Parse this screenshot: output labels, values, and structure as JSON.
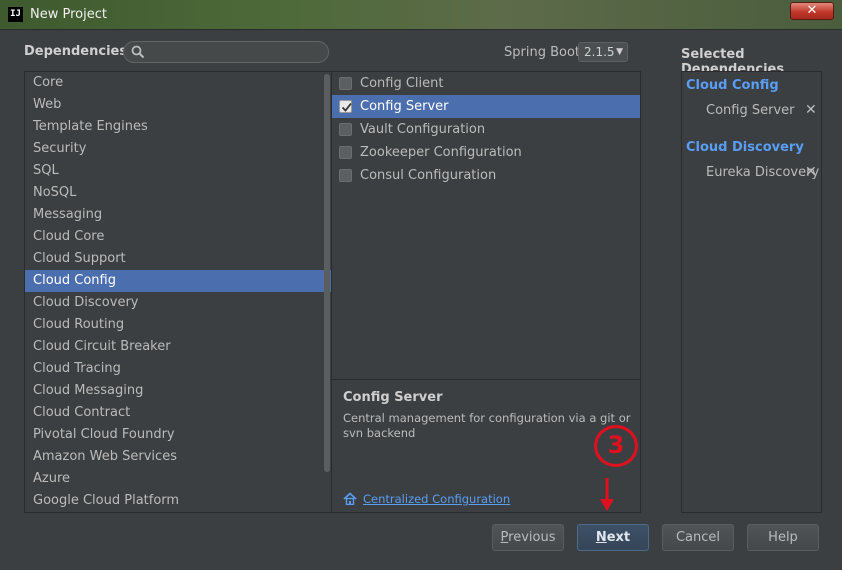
{
  "window": {
    "title": "New Project",
    "icon_text": "IJ",
    "close_label": "✕"
  },
  "header": {
    "dependencies_label": "Dependencies",
    "search_placeholder": "",
    "spring_boot_label": "Spring Boot",
    "spring_boot_version": "2.1.5",
    "selected_label": "Selected Dependencies"
  },
  "categories": [
    "Core",
    "Web",
    "Template Engines",
    "Security",
    "SQL",
    "NoSQL",
    "Messaging",
    "Cloud Core",
    "Cloud Support",
    "Cloud Config",
    "Cloud Discovery",
    "Cloud Routing",
    "Cloud Circuit Breaker",
    "Cloud Tracing",
    "Cloud Messaging",
    "Cloud Contract",
    "Pivotal Cloud Foundry",
    "Amazon Web Services",
    "Azure",
    "Google Cloud Platform"
  ],
  "selected_category": "Cloud Config",
  "dependencies": [
    {
      "label": "Config Client",
      "checked": false
    },
    {
      "label": "Config Server",
      "checked": true
    },
    {
      "label": "Vault Configuration",
      "checked": false
    },
    {
      "label": "Zookeeper Configuration",
      "checked": false
    },
    {
      "label": "Consul Configuration",
      "checked": false
    }
  ],
  "description": {
    "title": "Config Server",
    "text": "Central management for configuration via a git or svn backend",
    "link": "Centralized Configuration"
  },
  "selected_dependencies": [
    {
      "group": "Cloud Config",
      "items": [
        "Config Server"
      ]
    },
    {
      "group": "Cloud Discovery",
      "items": [
        "Eureka Discovery"
      ]
    }
  ],
  "annotation": {
    "number": "3"
  },
  "buttons": {
    "previous_first": "P",
    "previous_rest": "revious",
    "next_first": "N",
    "next_rest": "ext",
    "cancel": "Cancel",
    "help": "Help"
  },
  "colors": {
    "accent": "#4b6eaf",
    "link": "#589df6",
    "annotation": "#e0101f"
  }
}
